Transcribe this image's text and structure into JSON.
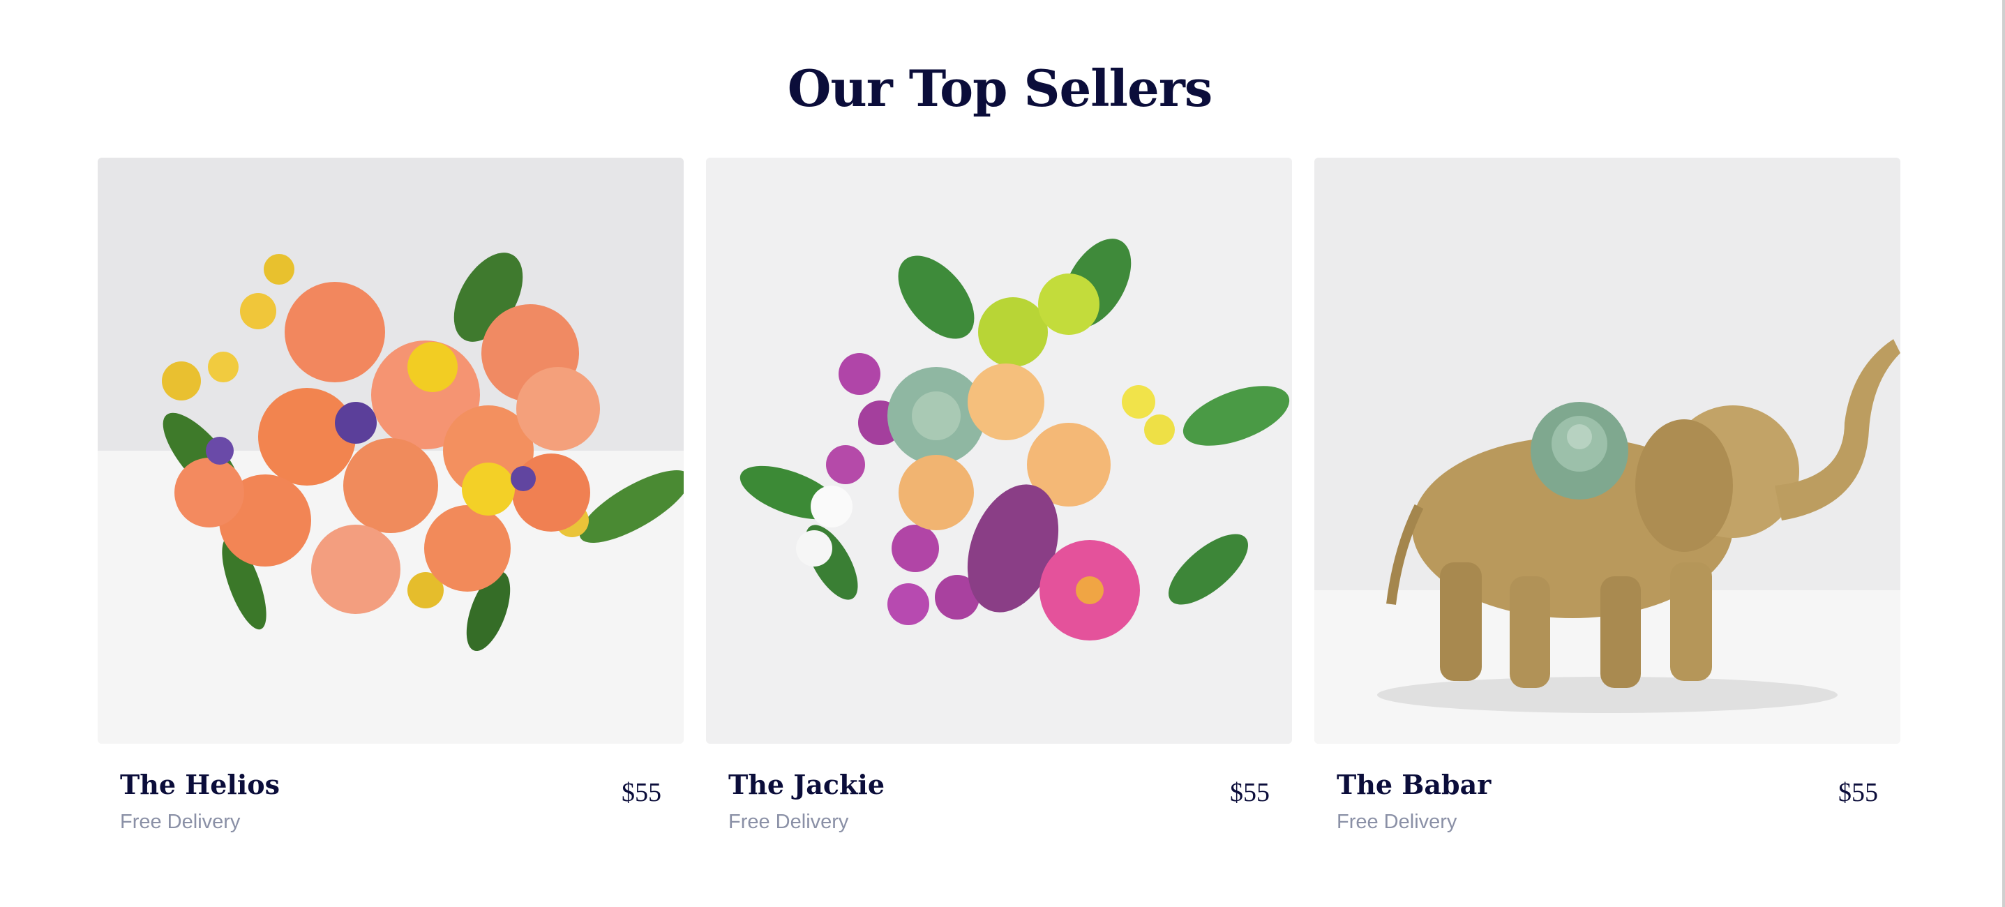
{
  "section": {
    "title": "Our Top Sellers"
  },
  "products": [
    {
      "name": "The Helios",
      "subtitle": "Free Delivery",
      "price": "$55",
      "image_icon": "orange-rose-bouquet"
    },
    {
      "name": "The Jackie",
      "subtitle": "Free Delivery",
      "price": "$55",
      "image_icon": "mixed-succulent-bouquet"
    },
    {
      "name": "The Babar",
      "subtitle": "Free Delivery",
      "price": "$55",
      "image_icon": "gold-elephant-planter"
    }
  ],
  "colors": {
    "heading": "#0b0d3a",
    "subtitle": "#8a90a6",
    "image_bg": "#efefef"
  }
}
